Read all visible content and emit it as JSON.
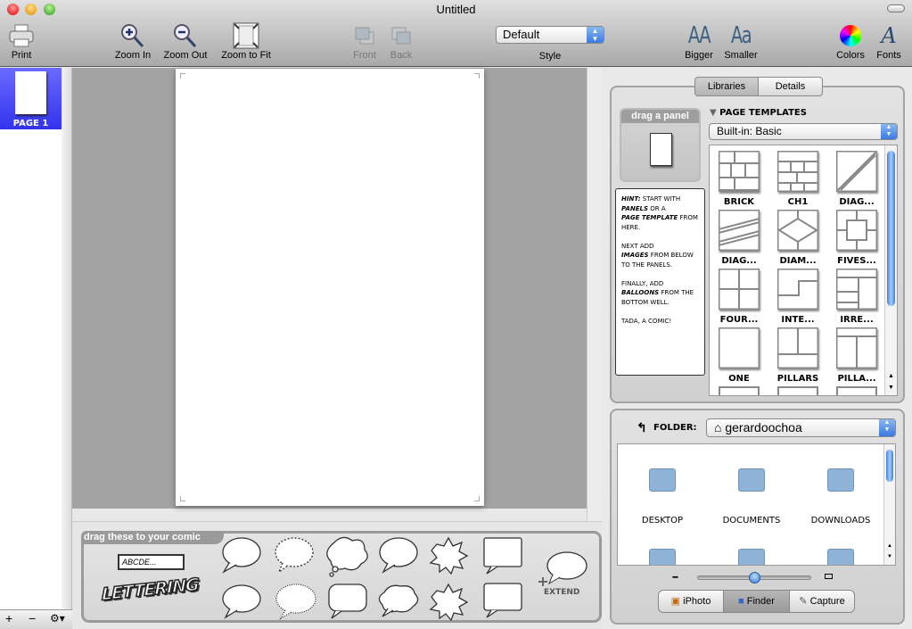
{
  "window": {
    "title": "Untitled"
  },
  "toolbar": {
    "print": "Print",
    "zoom_in": "Zoom In",
    "zoom_out": "Zoom Out",
    "zoom_fit": "Zoom to Fit",
    "front": "Front",
    "back": "Back",
    "style_value": "Default",
    "style_label": "Style",
    "bigger": "Bigger",
    "smaller": "Smaller",
    "colors": "Colors",
    "fonts": "Fonts",
    "bigger_glyph": "AA",
    "smaller_glyph": "Aa",
    "fonts_glyph": "A"
  },
  "pages": {
    "items": [
      {
        "label": "PAGE 1",
        "selected": true
      }
    ],
    "add": "+",
    "remove": "−",
    "gear": "⚙▾"
  },
  "well": {
    "title": "drag these to your comic",
    "text_box": "ABCDE...",
    "lettering": "LETTERING",
    "extend": "EXTEND"
  },
  "right": {
    "tabs": [
      {
        "label": "Libraries",
        "selected": true
      },
      {
        "label": "Details",
        "selected": false
      }
    ],
    "drag_panel": "drag a panel",
    "hint": [
      [
        "HINT:",
        " START WITH "
      ],
      [
        "PANELS",
        " OR A "
      ],
      [
        "PAGE TEMPLATE",
        " FROM HERE."
      ],
      [
        "",
        ""
      ],
      [
        "",
        "NEXT ADD "
      ],
      [
        "IMAGES",
        " FROM BELOW TO THE PANELS."
      ],
      [
        "",
        ""
      ],
      [
        "",
        "FINALLY, ADD "
      ],
      [
        "BALLOONS",
        " FROM THE BOTTOM WELL."
      ],
      [
        "",
        ""
      ],
      [
        "",
        "TADA, A COMIC!"
      ]
    ],
    "templates_header": "PAGE TEMPLATES",
    "templates_source": "Built-in: Basic",
    "templates": [
      "BRICK",
      "CH1",
      "DIAG...",
      "DIAG...",
      "DIAM...",
      "FIVES...",
      "FOUR...",
      "INTE...",
      "IRRE...",
      "ONE",
      "PILLARS",
      "PILLA..."
    ],
    "folder_label": "FOLDER:",
    "folder_value": "gerardoochoa",
    "files": [
      "DESKTOP",
      "DOCUMENTS",
      "DOWNLOADS"
    ],
    "sources": [
      {
        "label": "iPhoto",
        "selected": false
      },
      {
        "label": "Finder",
        "selected": true
      },
      {
        "label": "Capture",
        "selected": false
      }
    ],
    "thumb_size": 0.5
  },
  "colors": {
    "selection": "#4040f0",
    "accent": "#3a7ae0"
  }
}
